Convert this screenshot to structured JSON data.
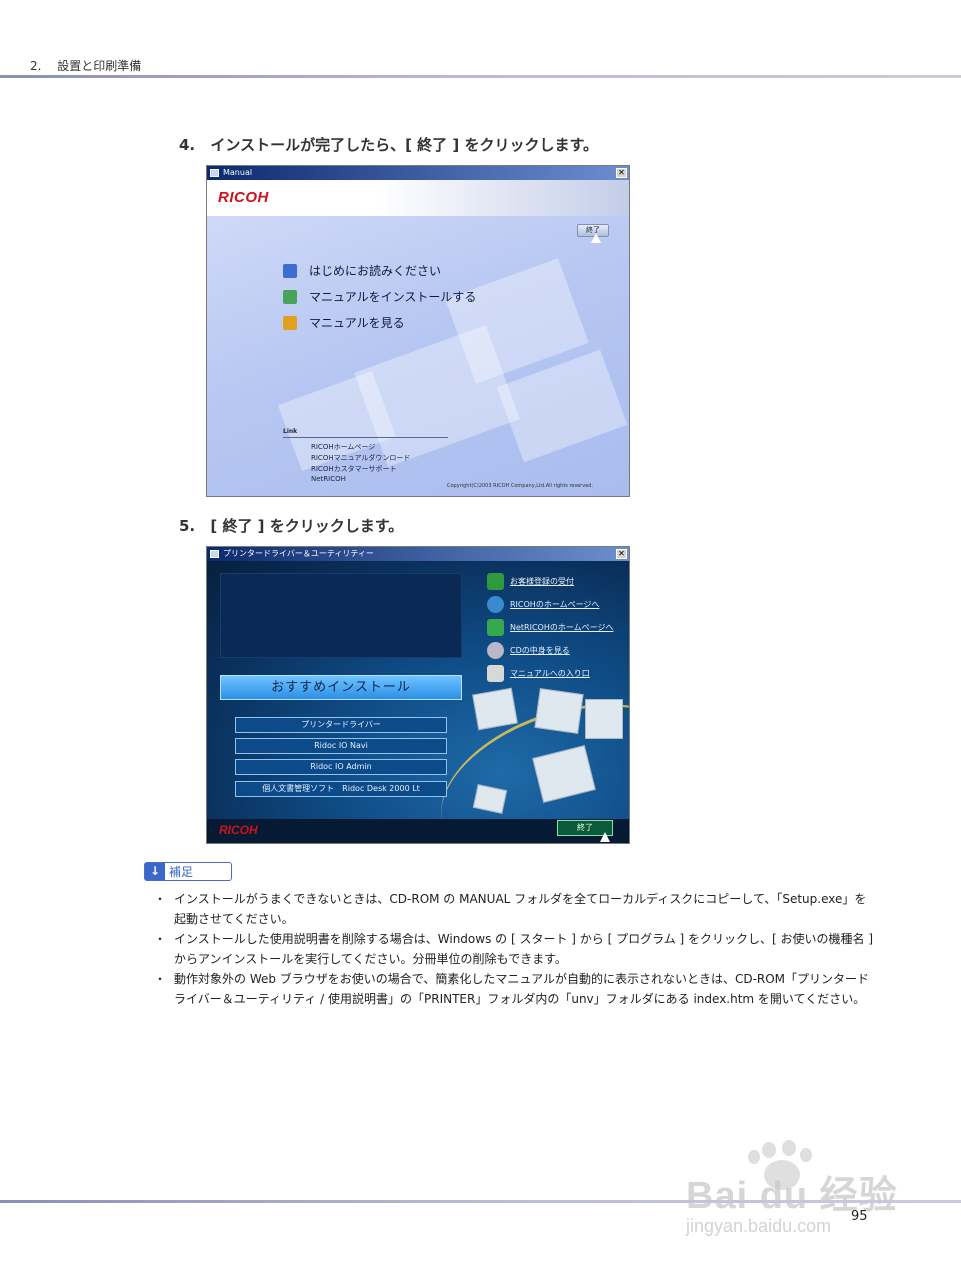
{
  "header": {
    "section": "2.",
    "title": "設置と印刷準備"
  },
  "steps": [
    {
      "num": "4.",
      "text": "インストールが完了したら、[ 終了 ] をクリックします。"
    },
    {
      "num": "5.",
      "text": "[ 終了 ] をクリックします。"
    }
  ],
  "screenshot1": {
    "window_title": "Manual",
    "close_glyph": "✕",
    "logo": "RICOH",
    "exit_label": "終了",
    "menu": [
      {
        "label": "はじめにお読みください",
        "icon": "book-icon",
        "color": "#3a6ed0"
      },
      {
        "label": "マニュアルをインストールする",
        "icon": "install-icon",
        "color": "#4aa35a"
      },
      {
        "label": "マニュアルを見る",
        "icon": "folder-icon",
        "color": "#e0a020"
      }
    ],
    "link_title": "Link",
    "links": [
      "RICOHホームページ",
      "RICOHマニュアルダウンロード",
      "RICOHカスタマーサポート",
      "NetRICOH"
    ],
    "copyright": "Copyright(C)2003 RICOH Company,Ltd.All rights reserved."
  },
  "screenshot2": {
    "window_title": "プリンタードライバー＆ユーティリティー",
    "close_glyph": "✕",
    "main_button": "おすすめインストール",
    "buttons": [
      "プリンタードライバー",
      "Ridoc IO Navi",
      "Ridoc IO Admin",
      "個人文書管理ソフト　Ridoc Desk 2000 Lt"
    ],
    "links": [
      {
        "label": "お客様登録の受付",
        "icon": "registration-icon",
        "color": "#2e9a3e"
      },
      {
        "label": "RICOHのホームページへ",
        "icon": "globe-icon",
        "color": "#3a8ad0"
      },
      {
        "label": "NetRICOHのホームページへ",
        "icon": "net-icon",
        "color": "#34a84a"
      },
      {
        "label": "CDの中身を見る",
        "icon": "cd-icon",
        "color": "#b8b8c8"
      },
      {
        "label": "マニュアルへの入り口",
        "icon": "manual-icon",
        "color": "#d8d8d8"
      }
    ],
    "logo": "RICOH",
    "exit_label": "終了"
  },
  "hint": {
    "label": "補足",
    "items": [
      "インストールがうまくできないときは、CD-ROM の MANUAL フォルダを全てローカルディスクにコピーして、「Setup.exe」を起動させてください。",
      "インストールした使用説明書を削除する場合は、Windows の [ スタート ] から [ プログラム ] をクリックし、[ お使いの機種名 ] からアンインストールを実行してください。分冊単位の削除もできます。",
      "動作対象外の Web ブラウザをお使いの場合で、簡素化したマニュアルが自動的に表示されないときは、CD-ROM「プリンタードライバー＆ユーティリティ / 使用説明書」の「PRINTER」フォルダ内の「unv」フォルダにある index.htm を開いてください。"
    ]
  },
  "page_number": "95",
  "watermark": {
    "main": "Bai du 经验",
    "sub": "jingyan.baidu.com"
  }
}
